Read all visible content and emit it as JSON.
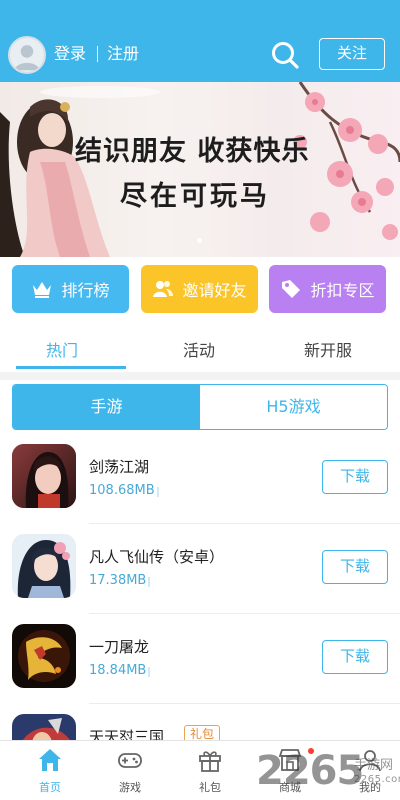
{
  "header": {
    "login_label": "登录",
    "register_label": "注册",
    "follow_label": "关注",
    "bg_color": "#3fb6ea"
  },
  "banner": {
    "line1": "结识朋友 收获快乐",
    "line2": "尽在可玩马"
  },
  "categories": [
    {
      "label": "排行榜",
      "icon": "crown-icon",
      "color": "#46baf0"
    },
    {
      "label": "邀请好友",
      "icon": "users-icon",
      "color": "#fbc52a"
    },
    {
      "label": "折扣专区",
      "icon": "tag-icon",
      "color": "#b880f0"
    }
  ],
  "tabs": [
    {
      "label": "热门",
      "active": true
    },
    {
      "label": "活动",
      "active": false
    },
    {
      "label": "新开服",
      "active": false
    }
  ],
  "segment": {
    "options": [
      "手游",
      "H5游戏"
    ],
    "selected": "手游"
  },
  "games": [
    {
      "name": "剑荡江湖",
      "size": "108.68MB",
      "action": "下载"
    },
    {
      "name": "凡人飞仙传（安卓）",
      "size": "17.38MB",
      "action": "下载"
    },
    {
      "name": "一刀屠龙",
      "size": "18.84MB",
      "action": "下载"
    },
    {
      "name": "天天怼三国",
      "badge": "礼包"
    }
  ],
  "bottom_nav": [
    {
      "label": "首页",
      "icon": "home-icon",
      "active": true
    },
    {
      "label": "游戏",
      "icon": "gamepad-icon",
      "active": false
    },
    {
      "label": "礼包",
      "icon": "gift-icon",
      "active": false
    },
    {
      "label": "商城",
      "icon": "store-icon",
      "active": false
    },
    {
      "label": "我的",
      "icon": "user-icon",
      "active": false
    }
  ],
  "watermark": {
    "main": "2265",
    "sub1": "手游网",
    "sub2": "2265.com"
  },
  "accent_color": "#3fb6ea"
}
